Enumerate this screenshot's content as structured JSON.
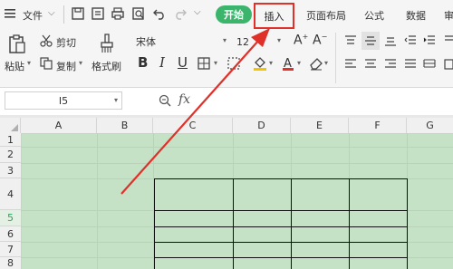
{
  "menu": {
    "file_label": "文件"
  },
  "tabs": {
    "start": "开始",
    "insert": "插入",
    "page_layout": "页面布局",
    "formula": "公式",
    "data": "数据",
    "review_partial": "审"
  },
  "clipboard": {
    "paste": "粘贴",
    "cut": "剪切",
    "copy": "复制",
    "format_painter": "格式刷"
  },
  "font": {
    "name": "宋体",
    "size": "12"
  },
  "name_box": {
    "value": "I5"
  },
  "formula_bar": {
    "fx": "fx"
  },
  "columns": [
    "A",
    "B",
    "C",
    "D",
    "E",
    "F",
    "G"
  ],
  "rows": [
    "1",
    "2",
    "3",
    "4",
    "5",
    "6",
    "7",
    "8"
  ],
  "colors": {
    "accent_green": "#3bb56b",
    "highlight_red": "#e0302a",
    "sheet_fill": "#c6e2c6"
  }
}
